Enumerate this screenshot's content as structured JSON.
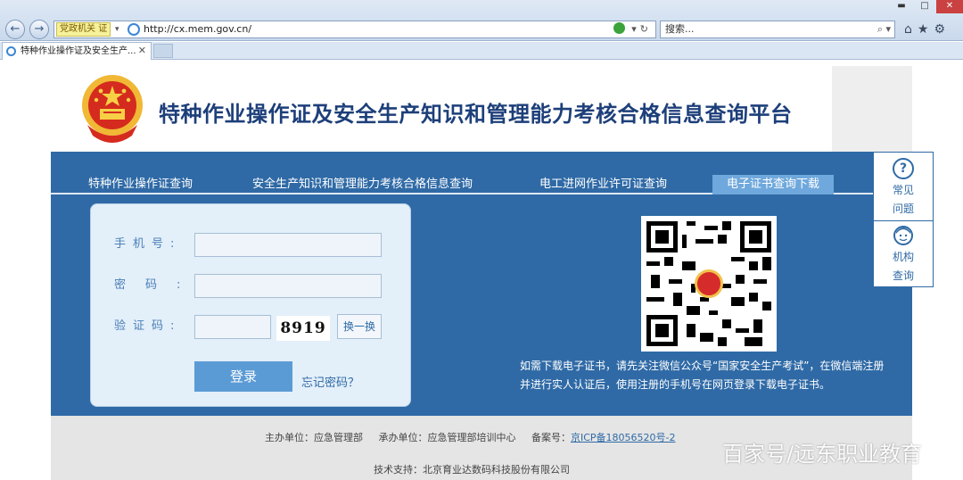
{
  "browser": {
    "favorites_label": "党政机关",
    "favorites_badge": "证",
    "url": "http://cx.mem.gov.cn/",
    "search_placeholder": "搜索...",
    "tab_title": "特种作业操作证及安全生产..."
  },
  "header": {
    "title": "特种作业操作证及安全生产知识和管理能力考核合格信息查询平台"
  },
  "nav": {
    "tabs": [
      {
        "label": "特种作业操作证查询"
      },
      {
        "label": "安全生产知识和管理能力考核合格信息查询"
      },
      {
        "label": "电工进网作业许可证查询"
      },
      {
        "label": "电子证书查询下载"
      }
    ],
    "active_index": 3
  },
  "login": {
    "phone_label": "手机号:",
    "password_label": "密码:",
    "captcha_label": "验证码:",
    "captcha_value": "8919",
    "refresh_label": "换一换",
    "login_button": "登录",
    "forgot_link": "忘记密码？"
  },
  "notice": {
    "text": "如需下载电子证书，请先关注微信公众号“国家安全生产考试”，在微信端注册并进行实人认证后，使用注册的手机号在网页登录下载电子证书。"
  },
  "side": {
    "faq_icon": "?",
    "faq_line1": "常见",
    "faq_line2": "问题",
    "org_line1": "机构",
    "org_line2": "查询"
  },
  "footer": {
    "sponsor": "主办单位：应急管理部",
    "organizer": "承办单位：应急管理部培训中心",
    "icp_label": "备案号：",
    "icp_link": "京ICP备18056520号-2",
    "support": "技术支持：北京育业达数码科技股份有限公司"
  },
  "watermark": "百家号/远东职业教育",
  "colors": {
    "primary": "#2f6aa6",
    "title": "#1d3f7a",
    "active_tab": "#6fa8dc",
    "login_bg": "#e3eff9",
    "button": "#5b9bd5"
  }
}
